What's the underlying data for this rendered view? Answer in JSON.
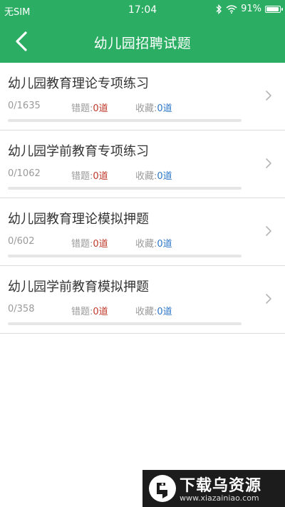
{
  "status_bar": {
    "carrier": "无SIM",
    "time": "17:04",
    "battery": "91%",
    "icons": [
      "bluetooth-icon",
      "wifi-icon",
      "battery-icon"
    ]
  },
  "nav": {
    "title": "幼儿园招聘试题",
    "back_icon": "back-arrow-icon"
  },
  "list": {
    "wrong_label": "错题:",
    "fav_label": "收藏:",
    "items": [
      {
        "name": "幼儿园教育理论专项练习",
        "progress": "0/1635",
        "progress_fraction": 0,
        "wrong": "0道",
        "fav": "0道"
      },
      {
        "name": "幼儿园学前教育专项练习",
        "progress": "0/1062",
        "progress_fraction": 0,
        "wrong": "0道",
        "fav": "0道"
      },
      {
        "name": "幼儿园教育理论模拟押题",
        "progress": "0/602",
        "progress_fraction": 0,
        "wrong": "0道",
        "fav": "0道"
      },
      {
        "name": "幼儿园学前教育模拟押题",
        "progress": "0/358",
        "progress_fraction": 0,
        "wrong": "0道",
        "fav": "0道"
      }
    ]
  },
  "watermark": {
    "brand": "下载乌资源",
    "url": "www.xiazainiao.com"
  },
  "colors": {
    "primary": "#2bae63",
    "wrong_count": "#c0392b",
    "fav_count": "#2e77c8"
  }
}
